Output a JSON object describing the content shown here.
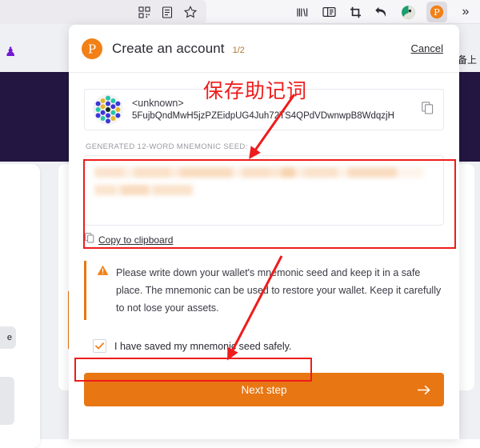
{
  "browser": {
    "left_icons": [
      {
        "name": "qr-code-icon",
        "glyph": "▦"
      },
      {
        "name": "reader-mode-icon",
        "glyph": "▤"
      },
      {
        "name": "bookmark-star-icon",
        "glyph": "☆"
      }
    ],
    "right_icons": [
      {
        "name": "library-icon"
      },
      {
        "name": "sidebar-icon"
      },
      {
        "name": "screenshot-crop-icon"
      },
      {
        "name": "back-arrow-icon"
      },
      {
        "name": "avatar-extension-icon"
      },
      {
        "name": "polkadot-extension-icon"
      },
      {
        "name": "overflow-chevron-icon",
        "glyph": "»"
      }
    ]
  },
  "background": {
    "banner_text": "设备上",
    "pill_text": "e"
  },
  "modal": {
    "title": "Create an account",
    "step": "1/2",
    "cancel_label": "Cancel",
    "account": {
      "name": "<unknown>",
      "address": "5FujbQndMwH5jzPZEidpUG4Juh72TS4QPdVDwnwpB8WdqzjH",
      "copy_icon": "copy-icon"
    },
    "seed": {
      "label": "GENERATED 12-WORD MNEMONIC SEED:",
      "value_redacted": true,
      "copy_link_label": "Copy to clipboard"
    },
    "warning": {
      "icon": "warning-triangle-icon",
      "text": "Please write down your wallet's mnemonic seed and keep it in a safe place. The mnemonic can be used to restore your wallet. Keep it carefully to not lose your assets."
    },
    "confirm": {
      "checked": true,
      "label": "I have saved my mnemonic seed safely."
    },
    "next_button": {
      "label": "Next step",
      "arrow": "arrow-right-icon"
    }
  },
  "annotation": {
    "note": "保存助记词",
    "color": "#ee1c1c"
  },
  "colors": {
    "accent_orange": "#e87613",
    "logo_orange": "#f28016",
    "annotation_red": "#ee1c1c",
    "banner_purple": "#231640"
  }
}
